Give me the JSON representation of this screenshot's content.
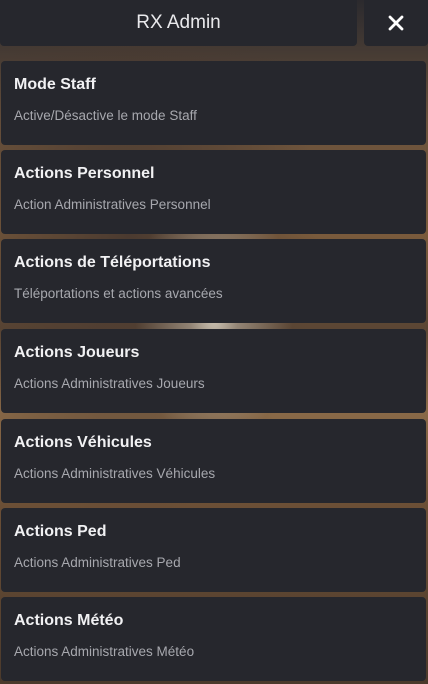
{
  "header": {
    "title": "RX Admin",
    "close_icon": "close-icon"
  },
  "menu": {
    "items": [
      {
        "label": "Mode Staff",
        "description": "Active/Désactive le mode Staff"
      },
      {
        "label": "Actions Personnel",
        "description": "Action Administratives Personnel"
      },
      {
        "label": "Actions de Téléportations",
        "description": "Téléportations et actions avancées"
      },
      {
        "label": "Actions Joueurs",
        "description": "Actions Administratives Joueurs"
      },
      {
        "label": "Actions Véhicules",
        "description": "Actions Administratives Véhicules"
      },
      {
        "label": "Actions Ped",
        "description": "Actions Administratives Ped"
      },
      {
        "label": "Actions Météo",
        "description": "Actions Administratives Météo"
      }
    ]
  },
  "colors": {
    "panel": "#26272d",
    "label": "#f1f1f3",
    "description": "#a7a8ae"
  }
}
